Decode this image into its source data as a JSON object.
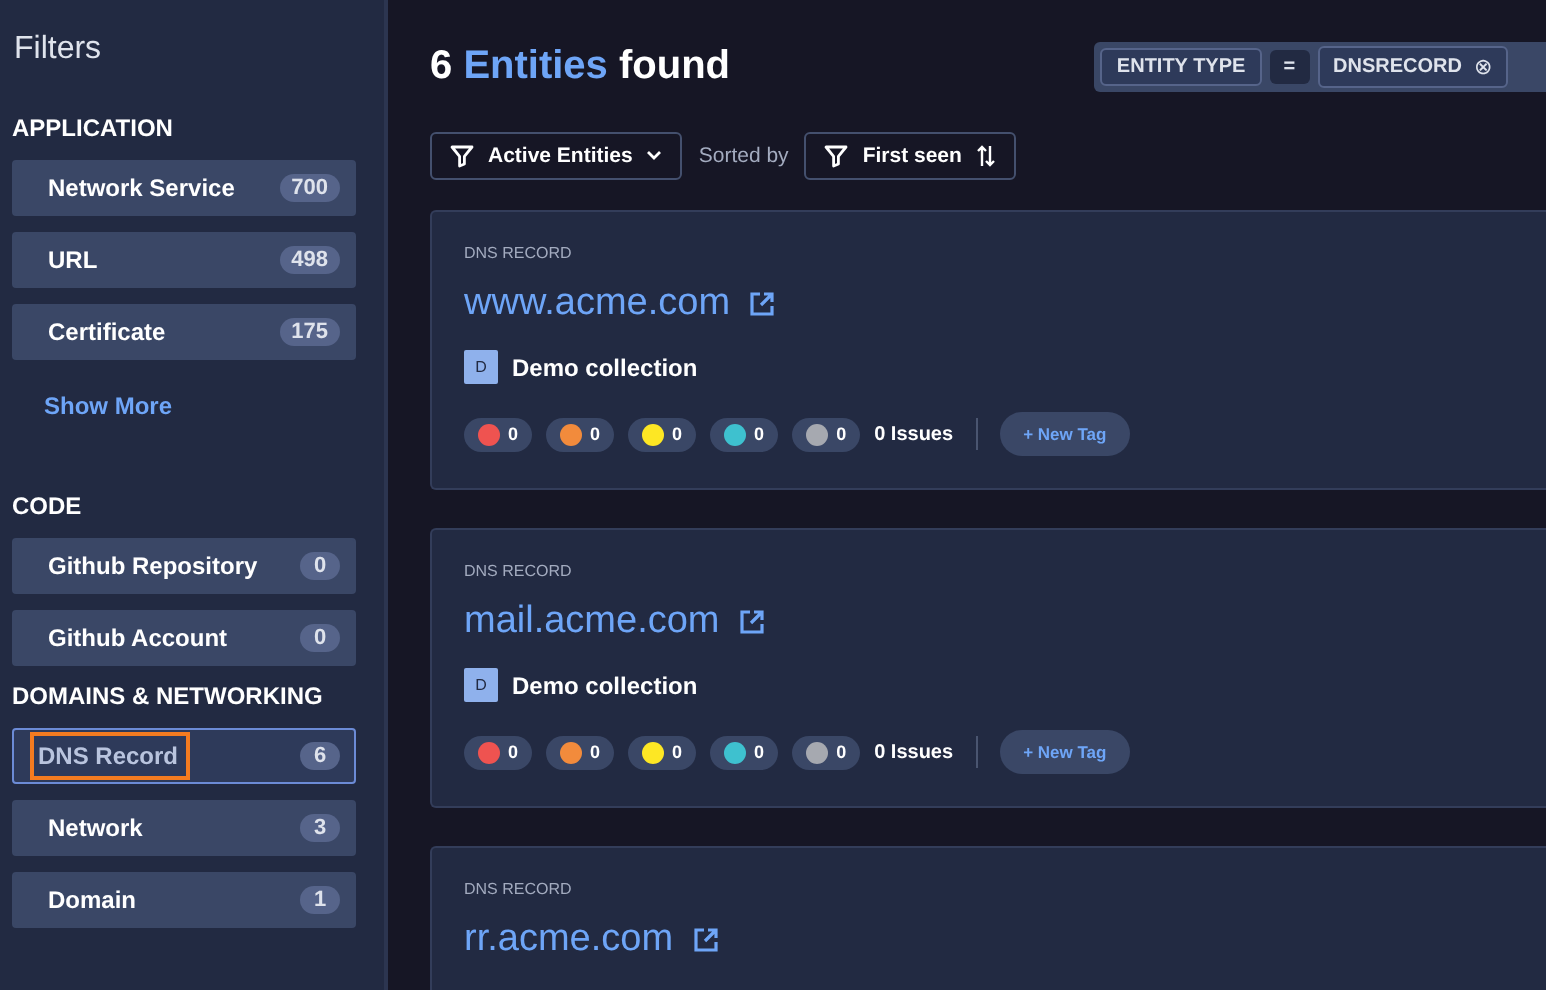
{
  "sidebar": {
    "title": "Filters",
    "sections": [
      {
        "heading": "APPLICATION",
        "items": [
          {
            "label": "Network Service",
            "count": "700",
            "selected": false,
            "highlighted": false
          },
          {
            "label": "URL",
            "count": "498",
            "selected": false,
            "highlighted": false
          },
          {
            "label": "Certificate",
            "count": "175",
            "selected": false,
            "highlighted": false
          }
        ],
        "show_more": "Show More"
      },
      {
        "heading": "CODE",
        "items": [
          {
            "label": "Github Repository",
            "count": "0",
            "selected": false,
            "highlighted": false
          },
          {
            "label": "Github Account",
            "count": "0",
            "selected": false,
            "highlighted": false
          }
        ]
      },
      {
        "heading": "DOMAINS & NETWORKING",
        "items": [
          {
            "label": "DNS Record",
            "count": "6",
            "selected": true,
            "highlighted": true
          },
          {
            "label": "Network",
            "count": "3",
            "selected": false,
            "highlighted": false
          },
          {
            "label": "Domain",
            "count": "1",
            "selected": false,
            "highlighted": false
          }
        ]
      }
    ]
  },
  "header": {
    "count": "6",
    "noun": "Entities",
    "suffix": "found"
  },
  "filter_chip": {
    "field": "ENTITY TYPE",
    "operator": "=",
    "value": "DNSRECORD",
    "remove": "⊗"
  },
  "toolbar": {
    "status_filter": "Active Entities",
    "sorted_by": "Sorted by",
    "sort": "First seen"
  },
  "entities": [
    {
      "type": "DNS RECORD",
      "name": "www.acme.com",
      "collection_initial": "D",
      "collection": "Demo collection",
      "severities": [
        {
          "color": "#ef5350",
          "count": "0"
        },
        {
          "color": "#f28b3c",
          "count": "0"
        },
        {
          "color": "#fde724",
          "count": "0"
        },
        {
          "color": "#3ec1cf",
          "count": "0"
        },
        {
          "color": "#a6a9b0",
          "count": "0"
        }
      ],
      "issues": "0 Issues",
      "new_tag": "+ New Tag"
    },
    {
      "type": "DNS RECORD",
      "name": "mail.acme.com",
      "collection_initial": "D",
      "collection": "Demo collection",
      "severities": [
        {
          "color": "#ef5350",
          "count": "0"
        },
        {
          "color": "#f28b3c",
          "count": "0"
        },
        {
          "color": "#fde724",
          "count": "0"
        },
        {
          "color": "#3ec1cf",
          "count": "0"
        },
        {
          "color": "#a6a9b0",
          "count": "0"
        }
      ],
      "issues": "0 Issues",
      "new_tag": "+ New Tag"
    },
    {
      "type": "DNS RECORD",
      "name": "rr.acme.com"
    }
  ]
}
